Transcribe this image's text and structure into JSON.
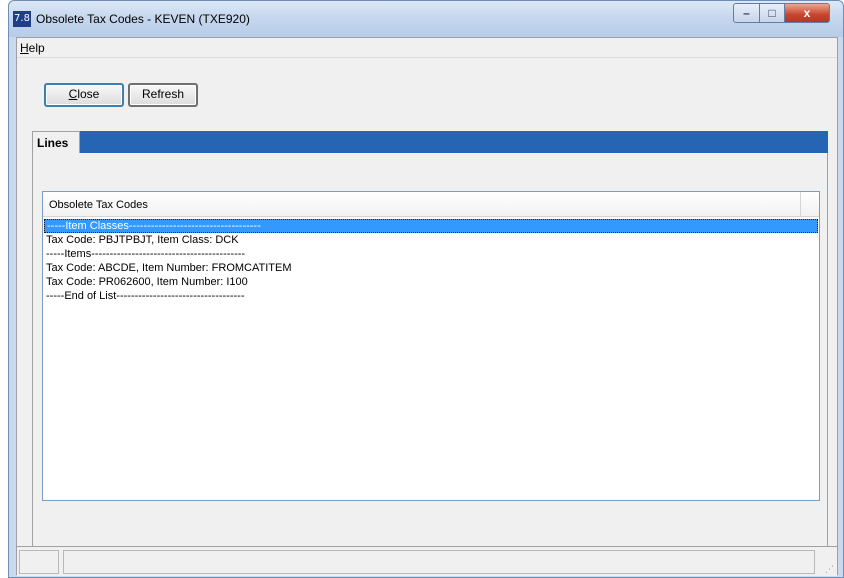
{
  "window": {
    "icon_text": "7.8",
    "title": "Obsolete Tax Codes - KEVEN (TXE920)",
    "controls": {
      "minimize_glyph": "–",
      "maximize_glyph": "□",
      "close_glyph": "x"
    }
  },
  "menubar": {
    "items": [
      {
        "label_underlined": "H",
        "label_rest": "elp"
      }
    ]
  },
  "toolbar": {
    "close_underlined": "C",
    "close_rest": "lose",
    "refresh_label": "Refresh"
  },
  "tabs": [
    {
      "label": "Lines"
    }
  ],
  "list": {
    "header": "Obsolete Tax Codes",
    "rows": [
      "-----Item Classes------------------------------------",
      "Tax Code: PBJTPBJT, Item Class: DCK",
      "-----Items------------------------------------------",
      "Tax Code: ABCDE, Item Number: FROMCATITEM",
      "Tax Code: PR062600, Item Number: I100",
      "-----End of List-----------------------------------"
    ],
    "selected_index": 0
  },
  "colors": {
    "tab_strip": "#2565b3",
    "selection": "#3399ff"
  }
}
